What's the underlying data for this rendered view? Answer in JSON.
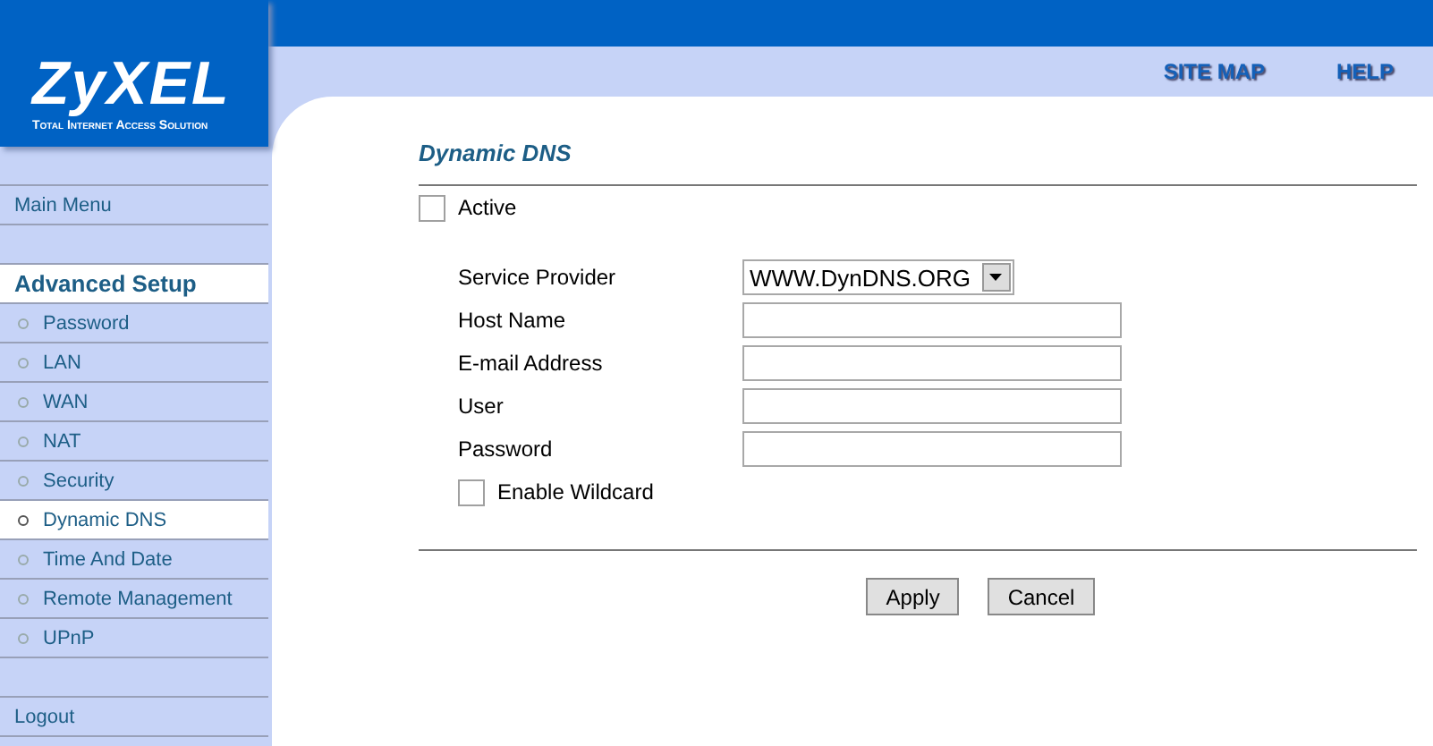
{
  "logo": {
    "name": "ZyXEL",
    "tagline": "Total Internet Access Solution"
  },
  "top_links": [
    "SITE MAP",
    "HELP"
  ],
  "sidebar": {
    "items": [
      {
        "kind": "blank"
      },
      {
        "kind": "link",
        "label": "Main Menu",
        "selected": false
      },
      {
        "kind": "blank"
      },
      {
        "kind": "header",
        "label": "Advanced Setup"
      },
      {
        "kind": "sub",
        "label": "Password",
        "selected": false
      },
      {
        "kind": "sub",
        "label": "LAN",
        "selected": false
      },
      {
        "kind": "sub",
        "label": "WAN",
        "selected": false
      },
      {
        "kind": "sub",
        "label": "NAT",
        "selected": false
      },
      {
        "kind": "sub",
        "label": "Security",
        "selected": false
      },
      {
        "kind": "sub",
        "label": "Dynamic DNS",
        "selected": true
      },
      {
        "kind": "sub",
        "label": "Time And Date",
        "selected": false
      },
      {
        "kind": "sub",
        "label": "Remote Management",
        "selected": false
      },
      {
        "kind": "sub",
        "label": "UPnP",
        "selected": false
      },
      {
        "kind": "blank"
      },
      {
        "kind": "link",
        "label": "Logout",
        "selected": false
      }
    ]
  },
  "page_title": "Dynamic DNS",
  "active": {
    "label": "Active",
    "checked": false
  },
  "fields": [
    {
      "kind": "select",
      "label": "Service Provider",
      "value": "WWW.DynDNS.ORG"
    },
    {
      "kind": "text",
      "label": "Host Name"
    },
    {
      "kind": "text",
      "label": "E-mail Address"
    },
    {
      "kind": "text",
      "label": "User"
    },
    {
      "kind": "text",
      "label": "Password"
    }
  ],
  "wildcard": {
    "label": "Enable Wildcard",
    "checked": false
  },
  "buttons": [
    "Apply",
    "Cancel"
  ]
}
